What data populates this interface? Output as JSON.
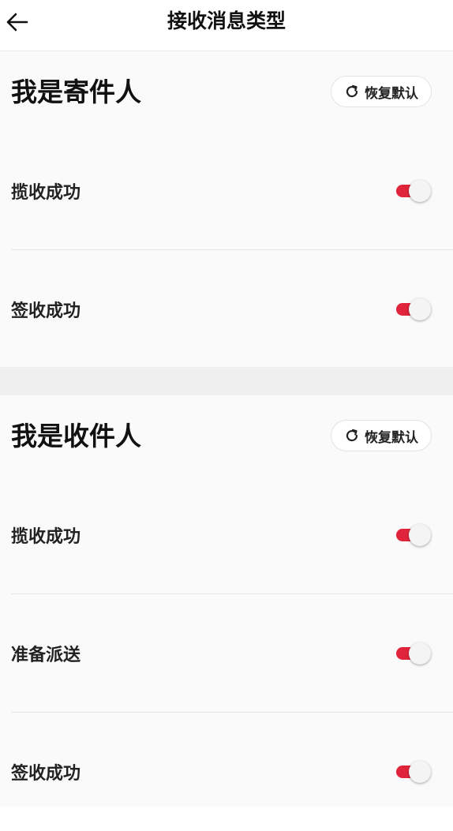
{
  "header": {
    "title": "接收消息类型"
  },
  "colors": {
    "accent": "#e0243c",
    "background": "#fafafa",
    "divider": "#e6e6e6"
  },
  "sender_section": {
    "title": "我是寄件人",
    "reset_label": "恢复默认",
    "items": [
      {
        "label": "揽收成功",
        "enabled": true
      },
      {
        "label": "签收成功",
        "enabled": true
      }
    ]
  },
  "receiver_section": {
    "title": "我是收件人",
    "reset_label": "恢复默认",
    "items": [
      {
        "label": "揽收成功",
        "enabled": true
      },
      {
        "label": "准备派送",
        "enabled": true
      },
      {
        "label": "签收成功",
        "enabled": true
      }
    ]
  }
}
